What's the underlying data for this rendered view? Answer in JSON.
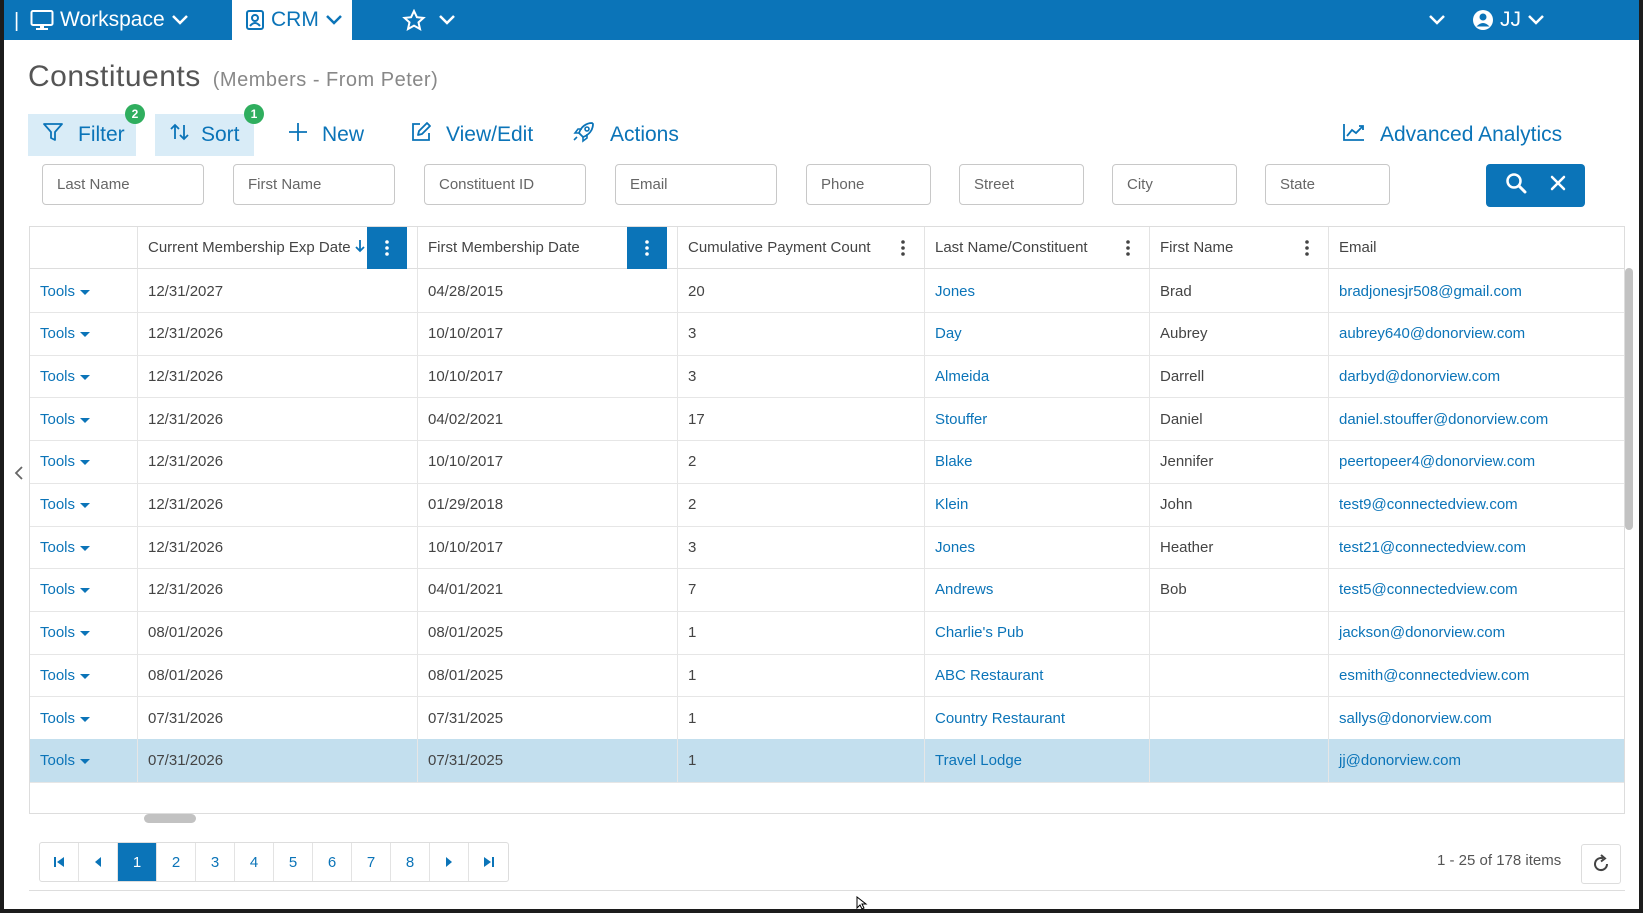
{
  "topbar": {
    "workspace_label": "Workspace",
    "crm_label": "CRM",
    "user_initials": "JJ"
  },
  "page": {
    "title": "Constituents",
    "subtitle": "(Members - From Peter)"
  },
  "toolbar": {
    "filter_label": "Filter",
    "filter_count": "2",
    "sort_label": "Sort",
    "sort_count": "1",
    "new_label": "New",
    "view_edit_label": "View/Edit",
    "actions_label": "Actions",
    "analytics_label": "Advanced Analytics"
  },
  "filters": {
    "last_name": "Last Name",
    "first_name": "First Name",
    "constituent_id": "Constituent ID",
    "email": "Email",
    "phone": "Phone",
    "street": "Street",
    "city": "City",
    "state": "State"
  },
  "grid": {
    "headers": {
      "exp_date": "Current Membership Exp Date",
      "first_date": "First Membership Date",
      "payment_count": "Cumulative Payment Count",
      "last_name": "Last Name/Constituent",
      "first_name": "First Name",
      "email": "Email"
    },
    "tools_label": "Tools",
    "rows": [
      {
        "exp": "12/31/2027",
        "first": "04/28/2015",
        "count": "20",
        "last": "Jones",
        "fname": "Brad",
        "email": "bradjonesjr508@gmail.com"
      },
      {
        "exp": "12/31/2026",
        "first": "10/10/2017",
        "count": "3",
        "last": "Day",
        "fname": "Aubrey",
        "email": "aubrey640@donorview.com"
      },
      {
        "exp": "12/31/2026",
        "first": "10/10/2017",
        "count": "3",
        "last": "Almeida",
        "fname": "Darrell",
        "email": "darbyd@donorview.com"
      },
      {
        "exp": "12/31/2026",
        "first": "04/02/2021",
        "count": "17",
        "last": "Stouffer",
        "fname": "Daniel",
        "email": "daniel.stouffer@donorview.com"
      },
      {
        "exp": "12/31/2026",
        "first": "10/10/2017",
        "count": "2",
        "last": "Blake",
        "fname": "Jennifer",
        "email": "peertopeer4@donorview.com"
      },
      {
        "exp": "12/31/2026",
        "first": "01/29/2018",
        "count": "2",
        "last": "Klein",
        "fname": "John",
        "email": "test9@connectedview.com"
      },
      {
        "exp": "12/31/2026",
        "first": "10/10/2017",
        "count": "3",
        "last": "Jones",
        "fname": "Heather",
        "email": "test21@connectedview.com"
      },
      {
        "exp": "12/31/2026",
        "first": "04/01/2021",
        "count": "7",
        "last": "Andrews",
        "fname": "Bob",
        "email": "test5@connectedview.com"
      },
      {
        "exp": "08/01/2026",
        "first": "08/01/2025",
        "count": "1",
        "last": "Charlie's Pub",
        "fname": "",
        "email": "jackson@donorview.com"
      },
      {
        "exp": "08/01/2026",
        "first": "08/01/2025",
        "count": "1",
        "last": "ABC Restaurant",
        "fname": "",
        "email": "esmith@connectedview.com"
      },
      {
        "exp": "07/31/2026",
        "first": "07/31/2025",
        "count": "1",
        "last": "Country Restaurant",
        "fname": "",
        "email": "sallys@donorview.com"
      },
      {
        "exp": "07/31/2026",
        "first": "07/31/2025",
        "count": "1",
        "last": "Travel Lodge",
        "fname": "",
        "email": "jj@donorview.com",
        "selected": true
      }
    ]
  },
  "pager": {
    "pages": [
      "1",
      "2",
      "3",
      "4",
      "5",
      "6",
      "7",
      "8"
    ],
    "current": "1",
    "info": "1 - 25 of 178 items"
  },
  "colors": {
    "brand": "#0b74b8",
    "badge": "#2fae5e",
    "selected_row": "#c3dfee"
  }
}
